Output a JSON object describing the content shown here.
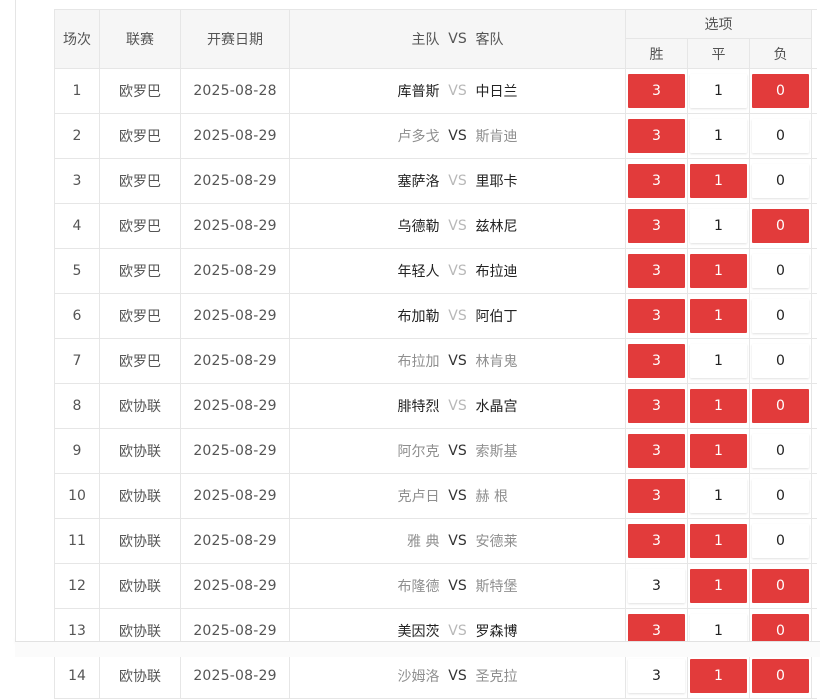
{
  "header": {
    "no": "场次",
    "league": "联赛",
    "date": "开赛日期",
    "home": "主队",
    "vs": "VS",
    "away": "客队",
    "options": "选项",
    "win": "胜",
    "draw": "平",
    "loss": "负"
  },
  "colors": {
    "selected": "#e23b3b",
    "unselected": "#ffffff",
    "header_bg": "#f6f6f6",
    "border": "#e6e6e6"
  },
  "rows": [
    {
      "no": "1",
      "league": "欧罗巴",
      "date": "2025-08-28",
      "home": "库普斯",
      "vs": "VS",
      "away": "中日兰",
      "win": "3",
      "draw": "1",
      "loss": "0",
      "win_on": true,
      "draw_on": false,
      "loss_on": true,
      "style": "normal"
    },
    {
      "no": "2",
      "league": "欧罗巴",
      "date": "2025-08-29",
      "home": "卢多戈",
      "vs": "VS",
      "away": "斯肯迪",
      "win": "3",
      "draw": "1",
      "loss": "0",
      "win_on": true,
      "draw_on": false,
      "loss_on": false,
      "style": "muted"
    },
    {
      "no": "3",
      "league": "欧罗巴",
      "date": "2025-08-29",
      "home": "塞萨洛",
      "vs": "VS",
      "away": "里耶卡",
      "win": "3",
      "draw": "1",
      "loss": "0",
      "win_on": true,
      "draw_on": true,
      "loss_on": false,
      "style": "normal"
    },
    {
      "no": "4",
      "league": "欧罗巴",
      "date": "2025-08-29",
      "home": "乌德勒",
      "vs": "VS",
      "away": "兹林尼",
      "win": "3",
      "draw": "1",
      "loss": "0",
      "win_on": true,
      "draw_on": false,
      "loss_on": true,
      "style": "normal"
    },
    {
      "no": "5",
      "league": "欧罗巴",
      "date": "2025-08-29",
      "home": "年轻人",
      "vs": "VS",
      "away": "布拉迪",
      "win": "3",
      "draw": "1",
      "loss": "0",
      "win_on": true,
      "draw_on": true,
      "loss_on": false,
      "style": "normal"
    },
    {
      "no": "6",
      "league": "欧罗巴",
      "date": "2025-08-29",
      "home": "布加勒",
      "vs": "VS",
      "away": "阿伯丁",
      "win": "3",
      "draw": "1",
      "loss": "0",
      "win_on": true,
      "draw_on": true,
      "loss_on": false,
      "style": "normal"
    },
    {
      "no": "7",
      "league": "欧罗巴",
      "date": "2025-08-29",
      "home": "布拉加",
      "vs": "VS",
      "away": "林肯鬼",
      "win": "3",
      "draw": "1",
      "loss": "0",
      "win_on": true,
      "draw_on": false,
      "loss_on": false,
      "style": "muted"
    },
    {
      "no": "8",
      "league": "欧协联",
      "date": "2025-08-29",
      "home": "腓特烈",
      "vs": "VS",
      "away": "水晶宫",
      "win": "3",
      "draw": "1",
      "loss": "0",
      "win_on": true,
      "draw_on": true,
      "loss_on": true,
      "style": "normal"
    },
    {
      "no": "9",
      "league": "欧协联",
      "date": "2025-08-29",
      "home": "阿尔克",
      "vs": "VS",
      "away": "索斯基",
      "win": "3",
      "draw": "1",
      "loss": "0",
      "win_on": true,
      "draw_on": true,
      "loss_on": false,
      "style": "muted"
    },
    {
      "no": "10",
      "league": "欧协联",
      "date": "2025-08-29",
      "home": "克卢日",
      "vs": "VS",
      "away": "赫 根",
      "win": "3",
      "draw": "1",
      "loss": "0",
      "win_on": true,
      "draw_on": false,
      "loss_on": false,
      "style": "muted"
    },
    {
      "no": "11",
      "league": "欧协联",
      "date": "2025-08-29",
      "home": "雅 典",
      "vs": "VS",
      "away": "安德莱",
      "win": "3",
      "draw": "1",
      "loss": "0",
      "win_on": true,
      "draw_on": true,
      "loss_on": false,
      "style": "muted"
    },
    {
      "no": "12",
      "league": "欧协联",
      "date": "2025-08-29",
      "home": "布隆德",
      "vs": "VS",
      "away": "斯特堡",
      "win": "3",
      "draw": "1",
      "loss": "0",
      "win_on": false,
      "draw_on": true,
      "loss_on": true,
      "style": "muted"
    },
    {
      "no": "13",
      "league": "欧协联",
      "date": "2025-08-29",
      "home": "美因茨",
      "vs": "VS",
      "away": "罗森博",
      "win": "3",
      "draw": "1",
      "loss": "0",
      "win_on": true,
      "draw_on": false,
      "loss_on": true,
      "style": "normal"
    },
    {
      "no": "14",
      "league": "欧协联",
      "date": "2025-08-29",
      "home": "沙姆洛",
      "vs": "VS",
      "away": "圣克拉",
      "win": "3",
      "draw": "1",
      "loss": "0",
      "win_on": false,
      "draw_on": true,
      "loss_on": true,
      "style": "muted"
    }
  ]
}
